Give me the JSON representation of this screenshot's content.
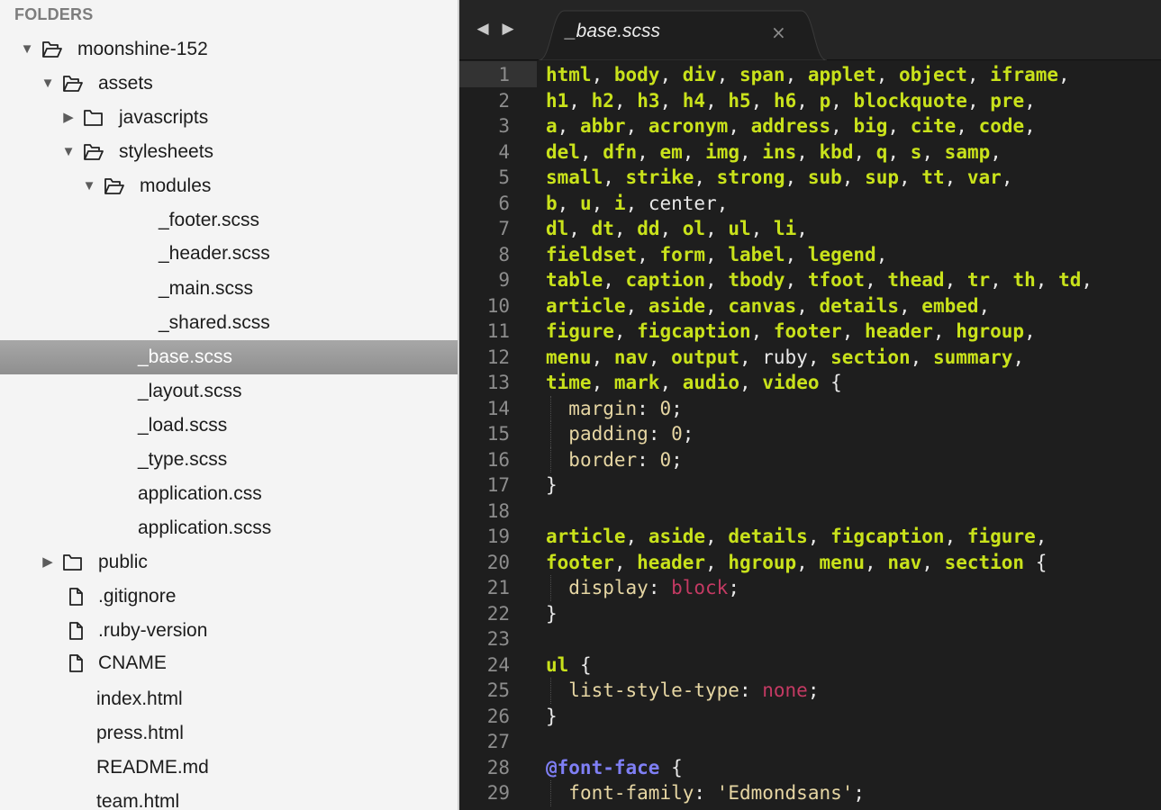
{
  "sidebar": {
    "header": "FOLDERS",
    "items": [
      {
        "label": "moonshine-152",
        "kind": "folder-open",
        "depth": 0
      },
      {
        "label": "assets",
        "kind": "folder-open",
        "depth": 1
      },
      {
        "label": "javascripts",
        "kind": "folder-closed",
        "depth": 2
      },
      {
        "label": "stylesheets",
        "kind": "folder-open",
        "depth": 2
      },
      {
        "label": "modules",
        "kind": "folder-open",
        "depth": 3
      },
      {
        "label": "_footer.scss",
        "kind": "file-plain",
        "depth": 4
      },
      {
        "label": "_header.scss",
        "kind": "file-plain",
        "depth": 4
      },
      {
        "label": "_main.scss",
        "kind": "file-plain",
        "depth": 4
      },
      {
        "label": "_shared.scss",
        "kind": "file-plain",
        "depth": 4
      },
      {
        "label": "_base.scss",
        "kind": "file-plain",
        "depth": 3,
        "selected": true
      },
      {
        "label": "_layout.scss",
        "kind": "file-plain",
        "depth": 3
      },
      {
        "label": "_load.scss",
        "kind": "file-plain",
        "depth": 3
      },
      {
        "label": "_type.scss",
        "kind": "file-plain",
        "depth": 3
      },
      {
        "label": "application.css",
        "kind": "file-plain",
        "depth": 3
      },
      {
        "label": "application.scss",
        "kind": "file-plain",
        "depth": 3
      },
      {
        "label": "public",
        "kind": "folder-closed",
        "depth": 1
      },
      {
        "label": ".gitignore",
        "kind": "file-icon",
        "depth": 1
      },
      {
        "label": ".ruby-version",
        "kind": "file-icon",
        "depth": 1
      },
      {
        "label": "CNAME",
        "kind": "file-icon",
        "depth": 1
      },
      {
        "label": "index.html",
        "kind": "file-plain",
        "depth": 1
      },
      {
        "label": "press.html",
        "kind": "file-plain",
        "depth": 1
      },
      {
        "label": "README.md",
        "kind": "file-plain",
        "depth": 1
      },
      {
        "label": "team.html",
        "kind": "file-plain",
        "depth": 1
      }
    ]
  },
  "tabbar": {
    "back_arrow": "◀",
    "forward_arrow": "▶",
    "active_tab": "_base.scss",
    "close_glyph": "×"
  },
  "colors": {
    "sidebar_bg": "#f4f4f4",
    "editor_bg": "#1e1e1e",
    "selector": "#c9e21b",
    "property": "#e6d6a3",
    "keyword": "#c43a63",
    "at_rule": "#7f7ff5"
  },
  "editor": {
    "lines": [
      [
        [
          "sel",
          "html"
        ],
        [
          "pl",
          ", "
        ],
        [
          "sel",
          "body"
        ],
        [
          "pl",
          ", "
        ],
        [
          "sel",
          "div"
        ],
        [
          "pl",
          ", "
        ],
        [
          "sel",
          "span"
        ],
        [
          "pl",
          ", "
        ],
        [
          "sel",
          "applet"
        ],
        [
          "pl",
          ", "
        ],
        [
          "sel",
          "object"
        ],
        [
          "pl",
          ", "
        ],
        [
          "sel",
          "iframe"
        ],
        [
          "pl",
          ","
        ]
      ],
      [
        [
          "sel",
          "h1"
        ],
        [
          "pl",
          ", "
        ],
        [
          "sel",
          "h2"
        ],
        [
          "pl",
          ", "
        ],
        [
          "sel",
          "h3"
        ],
        [
          "pl",
          ", "
        ],
        [
          "sel",
          "h4"
        ],
        [
          "pl",
          ", "
        ],
        [
          "sel",
          "h5"
        ],
        [
          "pl",
          ", "
        ],
        [
          "sel",
          "h6"
        ],
        [
          "pl",
          ", "
        ],
        [
          "sel",
          "p"
        ],
        [
          "pl",
          ", "
        ],
        [
          "sel",
          "blockquote"
        ],
        [
          "pl",
          ", "
        ],
        [
          "sel",
          "pre"
        ],
        [
          "pl",
          ","
        ]
      ],
      [
        [
          "sel",
          "a"
        ],
        [
          "pl",
          ", "
        ],
        [
          "sel",
          "abbr"
        ],
        [
          "pl",
          ", "
        ],
        [
          "sel",
          "acronym"
        ],
        [
          "pl",
          ", "
        ],
        [
          "sel",
          "address"
        ],
        [
          "pl",
          ", "
        ],
        [
          "sel",
          "big"
        ],
        [
          "pl",
          ", "
        ],
        [
          "sel",
          "cite"
        ],
        [
          "pl",
          ", "
        ],
        [
          "sel",
          "code"
        ],
        [
          "pl",
          ","
        ]
      ],
      [
        [
          "sel",
          "del"
        ],
        [
          "pl",
          ", "
        ],
        [
          "sel",
          "dfn"
        ],
        [
          "pl",
          ", "
        ],
        [
          "sel",
          "em"
        ],
        [
          "pl",
          ", "
        ],
        [
          "sel",
          "img"
        ],
        [
          "pl",
          ", "
        ],
        [
          "sel",
          "ins"
        ],
        [
          "pl",
          ", "
        ],
        [
          "sel",
          "kbd"
        ],
        [
          "pl",
          ", "
        ],
        [
          "sel",
          "q"
        ],
        [
          "pl",
          ", "
        ],
        [
          "sel",
          "s"
        ],
        [
          "pl",
          ", "
        ],
        [
          "sel",
          "samp"
        ],
        [
          "pl",
          ","
        ]
      ],
      [
        [
          "sel",
          "small"
        ],
        [
          "pl",
          ", "
        ],
        [
          "sel",
          "strike"
        ],
        [
          "pl",
          ", "
        ],
        [
          "sel",
          "strong"
        ],
        [
          "pl",
          ", "
        ],
        [
          "sel",
          "sub"
        ],
        [
          "pl",
          ", "
        ],
        [
          "sel",
          "sup"
        ],
        [
          "pl",
          ", "
        ],
        [
          "sel",
          "tt"
        ],
        [
          "pl",
          ", "
        ],
        [
          "sel",
          "var"
        ],
        [
          "pl",
          ","
        ]
      ],
      [
        [
          "sel",
          "b"
        ],
        [
          "pl",
          ", "
        ],
        [
          "sel",
          "u"
        ],
        [
          "pl",
          ", "
        ],
        [
          "sel",
          "i"
        ],
        [
          "pl",
          ", center,"
        ]
      ],
      [
        [
          "sel",
          "dl"
        ],
        [
          "pl",
          ", "
        ],
        [
          "sel",
          "dt"
        ],
        [
          "pl",
          ", "
        ],
        [
          "sel",
          "dd"
        ],
        [
          "pl",
          ", "
        ],
        [
          "sel",
          "ol"
        ],
        [
          "pl",
          ", "
        ],
        [
          "sel",
          "ul"
        ],
        [
          "pl",
          ", "
        ],
        [
          "sel",
          "li"
        ],
        [
          "pl",
          ","
        ]
      ],
      [
        [
          "sel",
          "fieldset"
        ],
        [
          "pl",
          ", "
        ],
        [
          "sel",
          "form"
        ],
        [
          "pl",
          ", "
        ],
        [
          "sel",
          "label"
        ],
        [
          "pl",
          ", "
        ],
        [
          "sel",
          "legend"
        ],
        [
          "pl",
          ","
        ]
      ],
      [
        [
          "sel",
          "table"
        ],
        [
          "pl",
          ", "
        ],
        [
          "sel",
          "caption"
        ],
        [
          "pl",
          ", "
        ],
        [
          "sel",
          "tbody"
        ],
        [
          "pl",
          ", "
        ],
        [
          "sel",
          "tfoot"
        ],
        [
          "pl",
          ", "
        ],
        [
          "sel",
          "thead"
        ],
        [
          "pl",
          ", "
        ],
        [
          "sel",
          "tr"
        ],
        [
          "pl",
          ", "
        ],
        [
          "sel",
          "th"
        ],
        [
          "pl",
          ", "
        ],
        [
          "sel",
          "td"
        ],
        [
          "pl",
          ","
        ]
      ],
      [
        [
          "sel",
          "article"
        ],
        [
          "pl",
          ", "
        ],
        [
          "sel",
          "aside"
        ],
        [
          "pl",
          ", "
        ],
        [
          "sel",
          "canvas"
        ],
        [
          "pl",
          ", "
        ],
        [
          "sel",
          "details"
        ],
        [
          "pl",
          ", "
        ],
        [
          "sel",
          "embed"
        ],
        [
          "pl",
          ","
        ]
      ],
      [
        [
          "sel",
          "figure"
        ],
        [
          "pl",
          ", "
        ],
        [
          "sel",
          "figcaption"
        ],
        [
          "pl",
          ", "
        ],
        [
          "sel",
          "footer"
        ],
        [
          "pl",
          ", "
        ],
        [
          "sel",
          "header"
        ],
        [
          "pl",
          ", "
        ],
        [
          "sel",
          "hgroup"
        ],
        [
          "pl",
          ","
        ]
      ],
      [
        [
          "sel",
          "menu"
        ],
        [
          "pl",
          ", "
        ],
        [
          "sel",
          "nav"
        ],
        [
          "pl",
          ", "
        ],
        [
          "sel",
          "output"
        ],
        [
          "pl",
          ", ruby, "
        ],
        [
          "sel",
          "section"
        ],
        [
          "pl",
          ", "
        ],
        [
          "sel",
          "summary"
        ],
        [
          "pl",
          ","
        ]
      ],
      [
        [
          "sel",
          "time"
        ],
        [
          "pl",
          ", "
        ],
        [
          "sel",
          "mark"
        ],
        [
          "pl",
          ", "
        ],
        [
          "sel",
          "audio"
        ],
        [
          "pl",
          ", "
        ],
        [
          "sel",
          "video"
        ],
        [
          "pl",
          " {"
        ]
      ],
      [
        [
          "ind",
          ""
        ],
        [
          "prop",
          "margin"
        ],
        [
          "pl",
          ": "
        ],
        [
          "prop",
          "0"
        ],
        [
          "pl",
          ";"
        ]
      ],
      [
        [
          "ind",
          ""
        ],
        [
          "prop",
          "padding"
        ],
        [
          "pl",
          ": "
        ],
        [
          "prop",
          "0"
        ],
        [
          "pl",
          ";"
        ]
      ],
      [
        [
          "ind",
          ""
        ],
        [
          "prop",
          "border"
        ],
        [
          "pl",
          ": "
        ],
        [
          "prop",
          "0"
        ],
        [
          "pl",
          ";"
        ]
      ],
      [
        [
          "pl",
          "}"
        ]
      ],
      [],
      [
        [
          "sel",
          "article"
        ],
        [
          "pl",
          ", "
        ],
        [
          "sel",
          "aside"
        ],
        [
          "pl",
          ", "
        ],
        [
          "sel",
          "details"
        ],
        [
          "pl",
          ", "
        ],
        [
          "sel",
          "figcaption"
        ],
        [
          "pl",
          ", "
        ],
        [
          "sel",
          "figure"
        ],
        [
          "pl",
          ","
        ]
      ],
      [
        [
          "sel",
          "footer"
        ],
        [
          "pl",
          ", "
        ],
        [
          "sel",
          "header"
        ],
        [
          "pl",
          ", "
        ],
        [
          "sel",
          "hgroup"
        ],
        [
          "pl",
          ", "
        ],
        [
          "sel",
          "menu"
        ],
        [
          "pl",
          ", "
        ],
        [
          "sel",
          "nav"
        ],
        [
          "pl",
          ", "
        ],
        [
          "sel",
          "section"
        ],
        [
          "pl",
          " {"
        ]
      ],
      [
        [
          "ind",
          ""
        ],
        [
          "prop",
          "display"
        ],
        [
          "pl",
          ": "
        ],
        [
          "kw",
          "block"
        ],
        [
          "pl",
          ";"
        ]
      ],
      [
        [
          "pl",
          "}"
        ]
      ],
      [],
      [
        [
          "sel",
          "ul"
        ],
        [
          "pl",
          " {"
        ]
      ],
      [
        [
          "ind",
          ""
        ],
        [
          "prop",
          "list-style-type"
        ],
        [
          "pl",
          ": "
        ],
        [
          "kw",
          "none"
        ],
        [
          "pl",
          ";"
        ]
      ],
      [
        [
          "pl",
          "}"
        ]
      ],
      [],
      [
        [
          "at",
          "@font-face"
        ],
        [
          "pl",
          " {"
        ]
      ],
      [
        [
          "ind",
          ""
        ],
        [
          "prop",
          "font-family"
        ],
        [
          "pl",
          ": "
        ],
        [
          "str",
          "'Edmondsans'"
        ],
        [
          "pl",
          ";"
        ]
      ]
    ]
  }
}
